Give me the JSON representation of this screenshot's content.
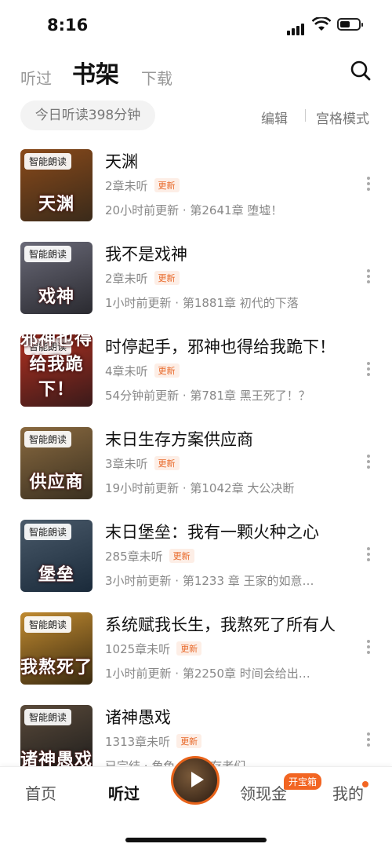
{
  "status": {
    "time": "8:16",
    "battery_level": 0.55
  },
  "tabs": {
    "listened": "听过",
    "shelf": "书架",
    "download": "下载",
    "active": "书架"
  },
  "toolbar": {
    "today": "今日听读398分钟",
    "edit": "编辑",
    "grid_mode": "宫格模式"
  },
  "books": [
    {
      "badge": "智能朗读",
      "cover_text": "天渊",
      "cover_colors": [
        "#3a2a1a",
        "#8a4a1a"
      ],
      "title": "天渊",
      "unread": "2章未听",
      "update_tag": "更新",
      "latest": "20小时前更新 · 第2641章 堕墟！"
    },
    {
      "badge": "智能朗读",
      "cover_text": "戏神",
      "cover_colors": [
        "#2a2a30",
        "#6a6a78"
      ],
      "title": "我不是戏神",
      "unread": "2章未听",
      "update_tag": "更新",
      "latest": "1小时前更新 · 第1881章 初代的下落"
    },
    {
      "badge": "智能朗读",
      "cover_text": "邪神也得给我跪下！",
      "cover_colors": [
        "#3a1a1a",
        "#b03020"
      ],
      "title": "时停起手，邪神也得给我跪下！",
      "unread": "4章未听",
      "update_tag": "更新",
      "latest": "54分钟前更新 · 第781章 黑王死了！？"
    },
    {
      "badge": "智能朗读",
      "cover_text": "供应商",
      "cover_colors": [
        "#3a3020",
        "#8a6a40"
      ],
      "title": "末日生存方案供应商",
      "unread": "3章未听",
      "update_tag": "更新",
      "latest": "19小时前更新 · 第1042章 大公决断"
    },
    {
      "badge": "智能朗读",
      "cover_text": "堡垒",
      "cover_colors": [
        "#1a2a3a",
        "#4a5a6a"
      ],
      "title": "末日堡垒：我有一颗火种之心",
      "unread": "285章未听",
      "update_tag": "更新",
      "latest": "3小时前更新 · 第1233 章 王家的如意…"
    },
    {
      "badge": "智能朗读",
      "cover_text": "我熬死了",
      "cover_colors": [
        "#3a2a10",
        "#c08a30"
      ],
      "title": "系统赋我长生，我熬死了所有人",
      "unread": "1025章未听",
      "update_tag": "更新",
      "latest": "1小时前更新 · 第2250章 时间会给出…"
    },
    {
      "badge": "智能朗读",
      "cover_text": "诸神愚戏",
      "cover_colors": [
        "#1a1a1a",
        "#5a4a3a"
      ],
      "title": "诸神愚戏",
      "unread": "1313章未听",
      "update_tag": "更新",
      "latest": "已完结 · 角色……专存老们"
    }
  ],
  "bottom_nav": {
    "home": "首页",
    "listened": "听过",
    "earn": "领现金",
    "treasure": "开宝箱",
    "mine": "我的"
  },
  "colors": {
    "accent": "#f26522"
  }
}
